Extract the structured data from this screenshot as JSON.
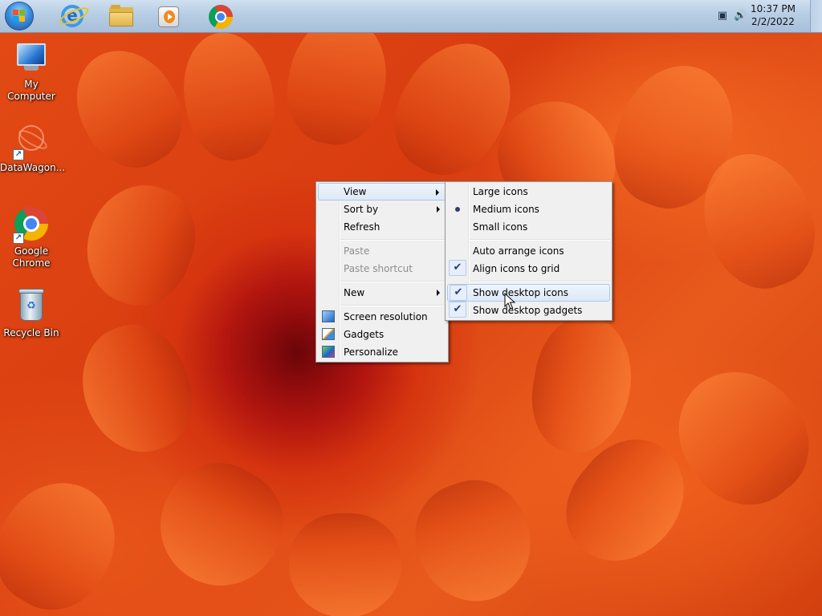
{
  "taskbar": {
    "start_button": "start",
    "pinned": [
      {
        "name": "internet-explorer",
        "icon": "ie-icon"
      },
      {
        "name": "windows-explorer",
        "icon": "folder-icon"
      },
      {
        "name": "media-player",
        "icon": "media-player-icon"
      },
      {
        "name": "google-chrome",
        "icon": "chrome-icon"
      }
    ],
    "tray": {
      "network_icon": "network-icon",
      "volume_icon": "volume-icon",
      "time": "10:37 PM",
      "date": "2/2/2022"
    }
  },
  "desktop": {
    "icons": [
      {
        "label": "My Computer",
        "icon": "computer-icon"
      },
      {
        "label": "DataWagon...",
        "icon": "datawagon-shortcut-icon"
      },
      {
        "label": "Google Chrome",
        "icon": "chrome-shortcut-icon"
      },
      {
        "label": "Recycle Bin",
        "icon": "recycle-bin-icon"
      }
    ]
  },
  "context_menu": {
    "items": [
      {
        "label": "View",
        "has_submenu": true,
        "highlighted": true
      },
      {
        "label": "Sort by",
        "has_submenu": true
      },
      {
        "label": "Refresh"
      },
      {
        "label": "Paste",
        "disabled": true
      },
      {
        "label": "Paste shortcut",
        "disabled": true
      },
      {
        "label": "New",
        "has_submenu": true
      },
      {
        "label": "Screen resolution",
        "icon": "screen-resolution-icon"
      },
      {
        "label": "Gadgets",
        "icon": "gadgets-icon"
      },
      {
        "label": "Personalize",
        "icon": "personalize-icon"
      }
    ]
  },
  "view_submenu": {
    "items": [
      {
        "label": "Large icons"
      },
      {
        "label": "Medium icons",
        "mark": "radio"
      },
      {
        "label": "Small icons"
      },
      {
        "label": "Auto arrange icons"
      },
      {
        "label": "Align icons to grid",
        "mark": "check"
      },
      {
        "label": "Show desktop icons",
        "mark": "check",
        "highlighted": true
      },
      {
        "label": "Show desktop gadgets",
        "mark": "check"
      }
    ]
  },
  "colors": {
    "taskbar": "#b5cce3",
    "menu_bg": "#f0f0f0",
    "highlight": "#dde9f8",
    "wallpaper": "#d9400f"
  }
}
